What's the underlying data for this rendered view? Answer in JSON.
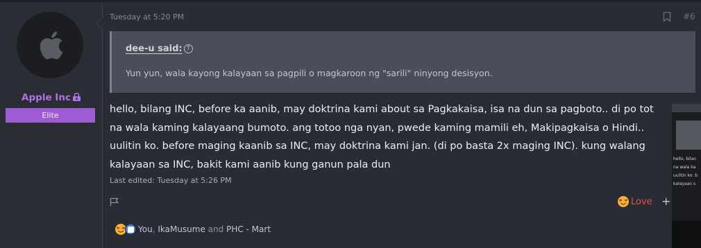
{
  "post": {
    "time": "Tuesday at 5:20 PM",
    "number": "#6",
    "author": {
      "name": "Apple Inc",
      "role": "Elite"
    },
    "quote": {
      "author": "dee-u said:",
      "text": "Yun yun, wala kayong kalayaan sa pagpili o magkaroon ng \"sarili\" ninyong desisyon."
    },
    "body_lines": [
      "hello, bilang INC, before ka aanib, may doktrina kami about sa Pagkakaisa, isa na dun sa pagboto.. di po tot",
      "na wala kaming kalayaang bumoto. ang totoo nga nyan, pwede kaming mamili eh, Makipagkaisa o Hindi..",
      "uulitin ko. before maging kaanib sa INC, may doktrina kami jan. (di po basta 2x maging INC). kung walang",
      "kalayaan sa INC, bakit kami aanib kung ganun pala dun"
    ],
    "last_edited": "Last edited: Tuesday at 5:26 PM",
    "react_label": "Love",
    "react_add": "+",
    "reactions": {
      "you": "You",
      "sep1": ", ",
      "user1": "IkaMusume",
      "sep2": " and ",
      "user2": "PHC - Mart"
    }
  },
  "preview": {
    "lines": [
      "hello, bilan",
      "na wala ka",
      "uulitin ko. b",
      "kalayaan s"
    ]
  },
  "colors": {
    "background": "#2a2c33",
    "username": "#b06fe6",
    "role_badge": "#9d5cd6",
    "quote_bg": "#4a4e58",
    "love": "#e04e4e"
  },
  "icons": [
    "apple-logo-icon",
    "lock-icon",
    "bookmark-icon",
    "quote-arrow-icon",
    "report-flag-icon",
    "love-emoji-icon",
    "like-emoji-icon"
  ]
}
